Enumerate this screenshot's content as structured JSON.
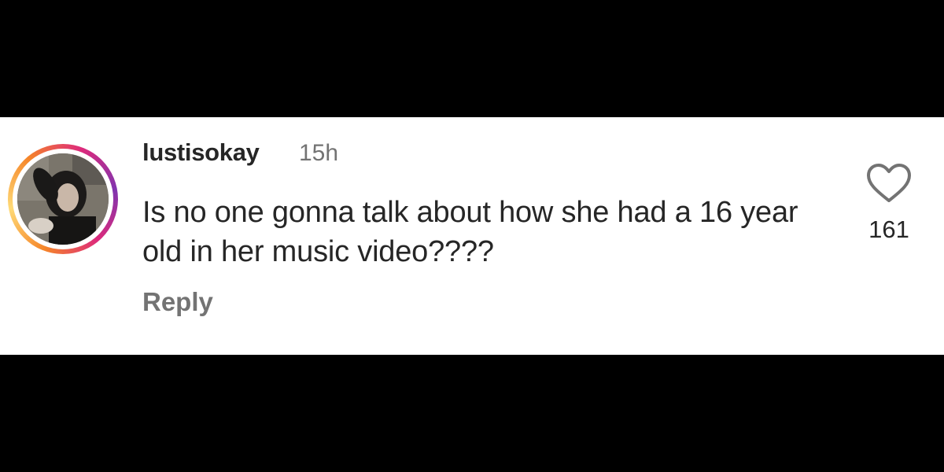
{
  "comment": {
    "username": "lustisokay",
    "time_ago": "15h",
    "text": "Is no one gonna talk about how she had a 16 year old in her music video????",
    "reply_label": "Reply",
    "like_count": "161"
  },
  "icons": {
    "like": "heart-outline-icon",
    "avatar_story_ring": "story-ring"
  },
  "colors": {
    "background_bars": "#000000",
    "panel": "#ffffff",
    "text_primary": "#262626",
    "text_secondary": "#737373",
    "story_ring_orange": "#f58529",
    "story_ring_pink": "#dd2a7b",
    "story_ring_purple": "#8134af"
  }
}
